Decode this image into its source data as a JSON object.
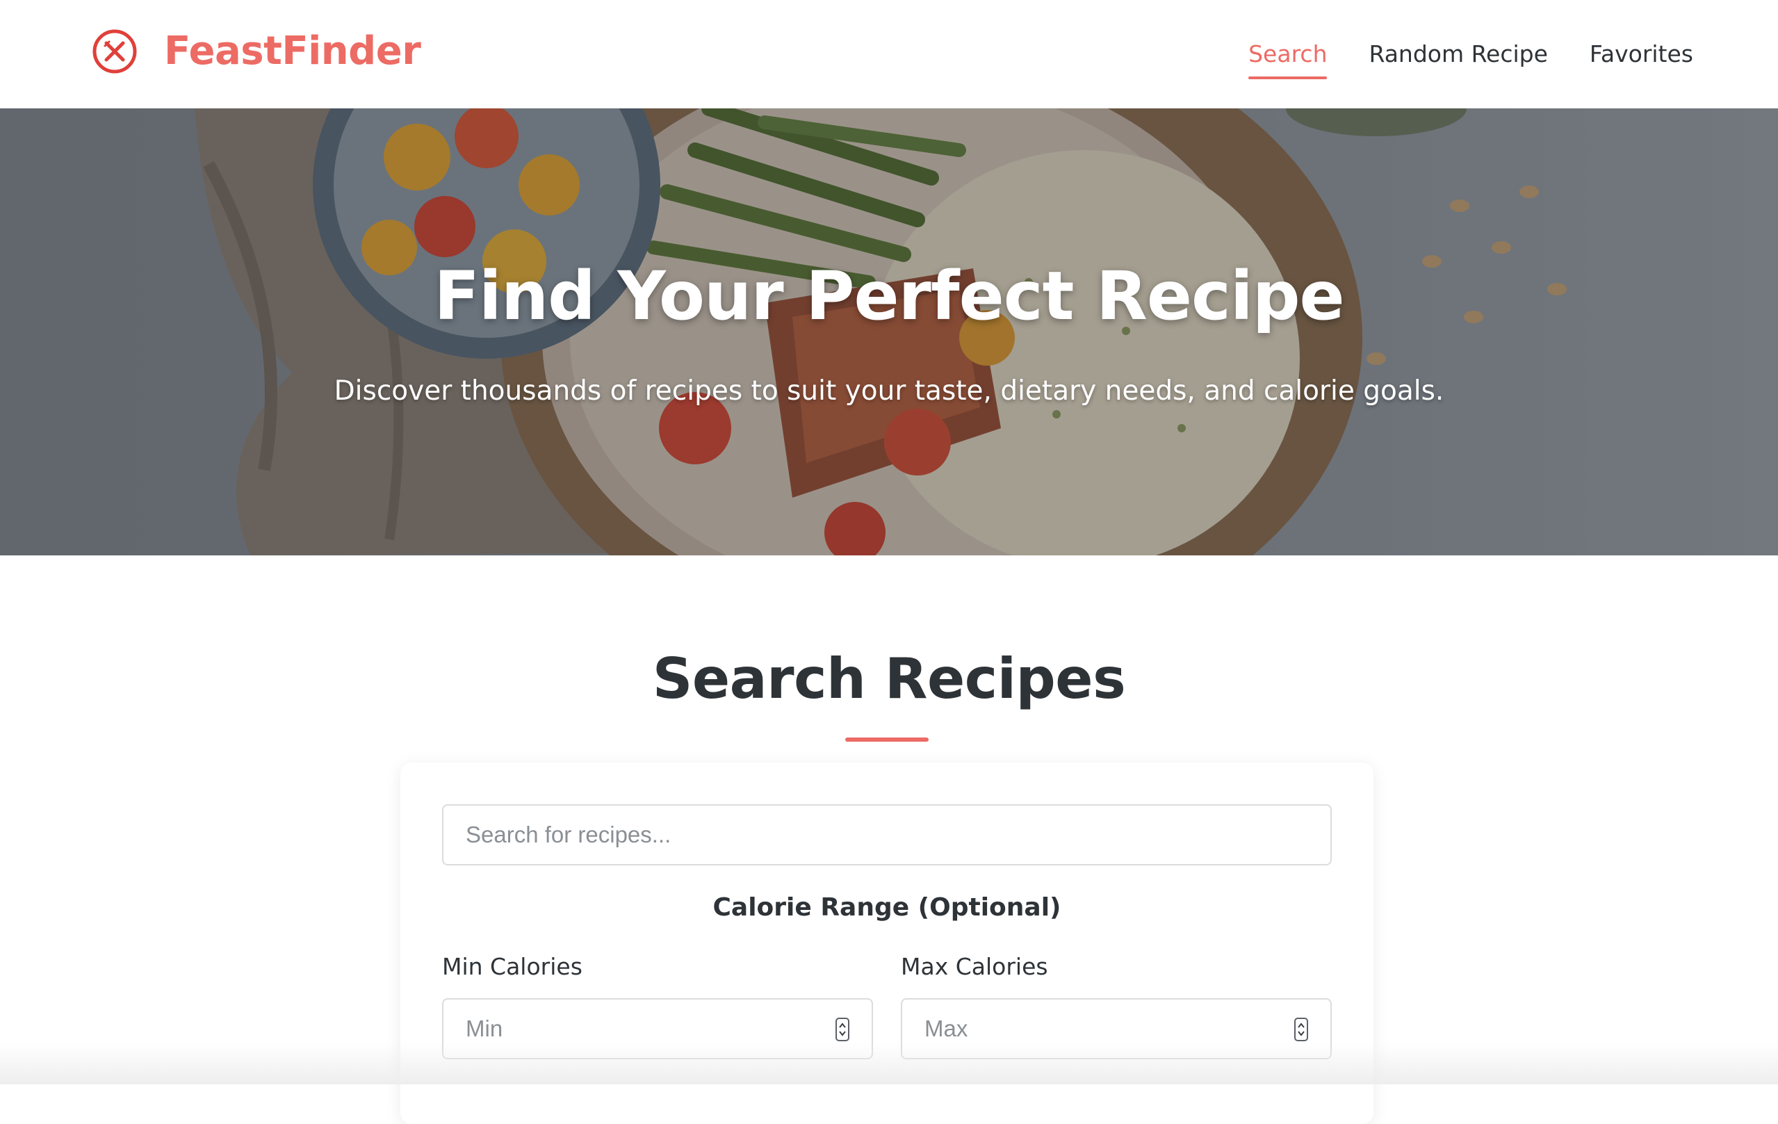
{
  "header": {
    "logo_text": "FeastFinder",
    "logo_icon": "utensils-circle-icon",
    "nav": [
      {
        "label": "Search",
        "active": true
      },
      {
        "label": "Random Recipe",
        "active": false
      },
      {
        "label": "Favorites",
        "active": false
      }
    ]
  },
  "hero": {
    "title": "Find Your Perfect Recipe",
    "subtitle": "Discover thousands of recipes to suit your taste, dietary needs, and calorie goals."
  },
  "search_section": {
    "title": "Search Recipes",
    "search_placeholder": "Search for recipes...",
    "calorie_range_title": "Calorie Range (Optional)",
    "min_label": "Min Calories",
    "min_placeholder": "Min",
    "max_label": "Max Calories",
    "max_placeholder": "Max"
  },
  "colors": {
    "accent": "#ec6b64",
    "text_dark": "#2e3338",
    "border": "#dcdcdc"
  }
}
